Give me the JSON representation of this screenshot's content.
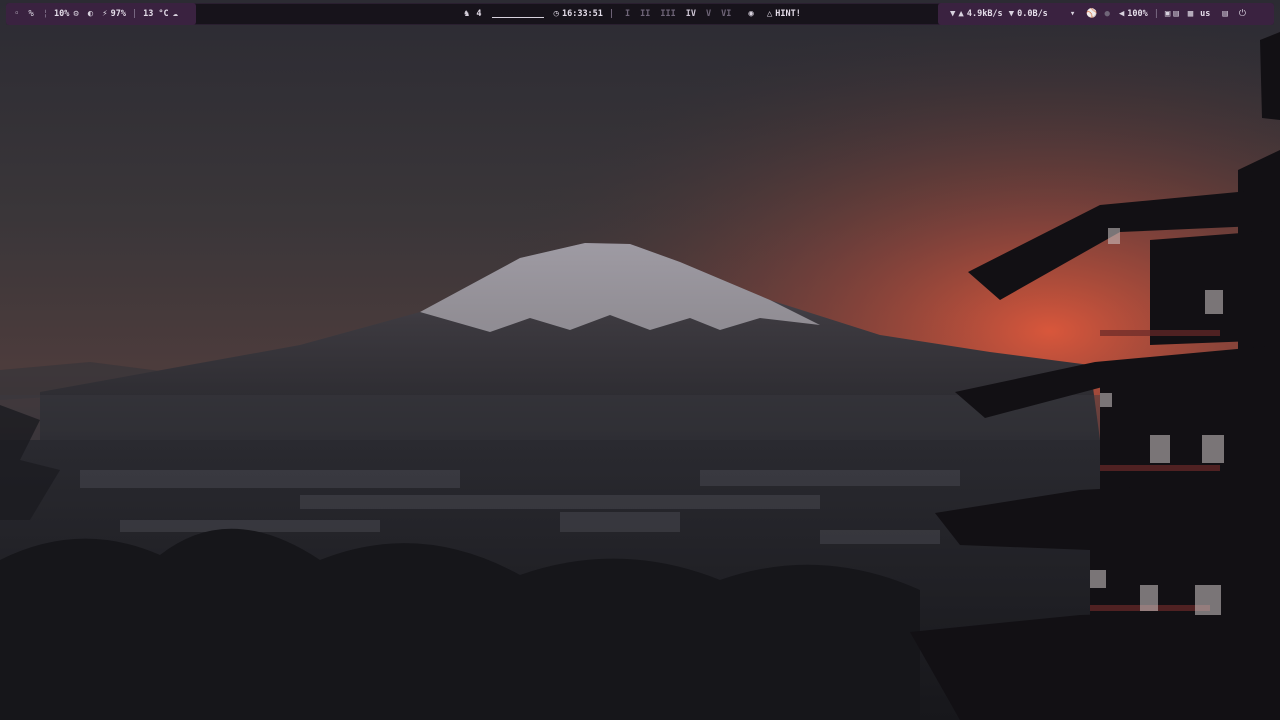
{
  "statusbar": {
    "left": {
      "cpu_icon": "drop-icon",
      "mem_icon": "percent-icon",
      "cpu_usage": "10%",
      "disk_icon": "gear-icon",
      "brightness_icon": "half-circle-icon",
      "battery_icon": "lightning-icon",
      "battery": "97%",
      "separator": "|",
      "temperature": "13 °C",
      "weather_icon": "cloud-icon"
    },
    "center": {
      "notification_icon": "bell-icon",
      "notification_count": "4",
      "clock_icon": "clock-icon",
      "time": "16:33:51",
      "separator": "|",
      "workspaces": [
        "I",
        "II",
        "III",
        "IV",
        "V",
        "VI"
      ],
      "eye_icon": "eye-icon",
      "hint_icon": "lamp-icon",
      "hint": "HINT!"
    },
    "right": {
      "wifi_icon": "wifi-icon",
      "upload_icon": "upload-icon",
      "upload_speed": "4.9kB/s",
      "download_icon": "download-icon",
      "download_speed": "0.0B/s",
      "network_icon": "wifi-icon",
      "headphone_icon": "headphone-icon",
      "mic_icon": "mic-icon",
      "volume_icon": "speaker-icon",
      "volume": "100%",
      "separator": "|",
      "screenshot_icon": "screenshot-icon",
      "lock_icon": "lock-icon",
      "keyboard_icon": "keyboard-icon",
      "layout": "us",
      "lock2_icon": "lock-icon",
      "power_icon": "power-icon"
    },
    "accent": "#3a2240",
    "background": "#17131b"
  }
}
